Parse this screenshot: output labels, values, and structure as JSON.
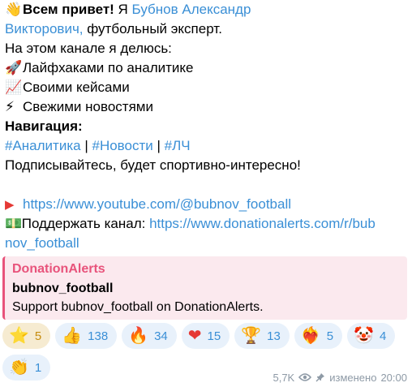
{
  "post": {
    "greeting_emoji": "👋",
    "greeting_bold": "Всем привет!",
    "greeting_pre": " Я ",
    "author_name_1": "Бубнов Александр",
    "author_name_2": "Викторович,",
    "author_role": " футбольный эксперт.",
    "share_intro": "На этом канале я делюсь:",
    "items": [
      {
        "emoji": "🚀",
        "text": "Лайфхаками по аналитике"
      },
      {
        "emoji": "📈",
        "text": "Своими кейсами"
      },
      {
        "emoji": "⚡",
        "text": "Свежими новостями"
      }
    ],
    "nav_title": "Навигация:",
    "nav_tags": [
      "#Аналитика",
      "#Новости",
      "#ЛЧ"
    ],
    "nav_sep": " | ",
    "subscribe": "Подписывайтесь, будет спортивно-интересно!",
    "youtube_emoji": "▶",
    "youtube_link": "https://www.youtube.com/@bubnov_football",
    "support_emoji": "💵",
    "support_label": " Поддержать канал: ",
    "support_link_1": "https://www.donationalerts.com/r/bub",
    "support_link_2": "nov_football"
  },
  "preview": {
    "site": "DonationAlerts",
    "title": "bubnov_football",
    "description": "Support bubnov_football on DonationAlerts."
  },
  "reactions": [
    {
      "icon": "⭐",
      "count": "5",
      "active": true,
      "icon_name": "star-icon"
    },
    {
      "icon": "👍",
      "count": "138",
      "icon_name": "thumbs-up-icon"
    },
    {
      "icon": "🔥",
      "count": "34",
      "icon_name": "fire-icon"
    },
    {
      "icon": "❤",
      "count": "15",
      "icon_name": "heart-icon"
    },
    {
      "icon": "🏆",
      "count": "13",
      "icon_name": "trophy-icon"
    },
    {
      "icon": "❤‍🔥",
      "count": "5",
      "icon_name": "heart-on-fire-icon"
    },
    {
      "icon": "🤡",
      "count": "4",
      "icon_name": "clown-icon"
    },
    {
      "icon": "👏",
      "count": "1",
      "icon_name": "clapping-hands-icon"
    }
  ],
  "footer": {
    "views": "5,7K",
    "edited_label": "изменено",
    "time": "20:00"
  },
  "colors": {
    "link": "#3a8fd6",
    "preview_accent": "#e8537b",
    "preview_bg": "#fbe9ee",
    "reaction_bg": "#e8f1fb",
    "paid_reaction_bg": "#f6ebd1",
    "meta": "#8e9aa6"
  }
}
